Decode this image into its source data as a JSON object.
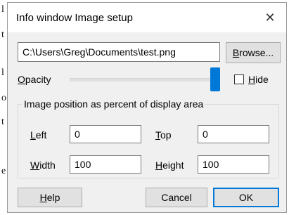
{
  "background_chars": [
    "l",
    "t",
    "l",
    "o",
    "t",
    "e"
  ],
  "dialog": {
    "title": "Info window Image setup",
    "close_symbol": "✕"
  },
  "file": {
    "path": "C:\\Users\\Greg\\Documents\\test.png",
    "browse_label_u": "B",
    "browse_label_rest": "rowse..."
  },
  "opacity": {
    "label_u": "O",
    "label_rest": "pacity",
    "level_percent": 100,
    "hide_label_u": "H",
    "hide_label_rest": "ide",
    "hide_checked": false
  },
  "position": {
    "legend": "Image position as percent of display area",
    "left_label_u": "L",
    "left_label_rest": "eft",
    "left_value": "0",
    "top_label_u": "T",
    "top_label_rest": "op",
    "top_value": "0",
    "width_label_u": "W",
    "width_label_rest": "idth",
    "width_value": "100",
    "height_label_u": "H",
    "height_label_rest": "eight",
    "height_value": "100"
  },
  "buttons": {
    "help_u": "H",
    "help_rest": "elp",
    "cancel": "Cancel",
    "ok": "OK"
  },
  "colors": {
    "accent": "#0078d7",
    "dialog_bg": "#f0f0f0"
  }
}
